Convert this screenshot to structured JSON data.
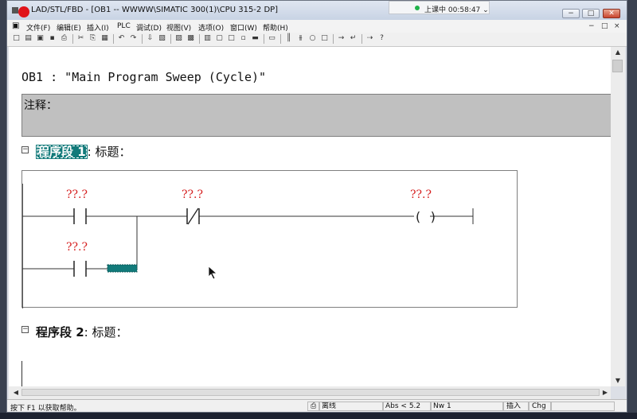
{
  "window": {
    "title": "LAD/STL/FBD  - [OB1 -- WWWW\\SIMATIC 300(1)\\CPU 315-2 DP]",
    "min_glyph": "−",
    "max_glyph": "□",
    "close_glyph": "✕"
  },
  "session": {
    "label": "上课中 00:58:47 ⌄"
  },
  "menu": {
    "items": [
      "文件(F)",
      "编辑(E)",
      "插入(I)",
      "PLC",
      "调试(D)",
      "视图(V)",
      "选项(O)",
      "窗口(W)",
      "帮助(H)"
    ],
    "mdi": [
      "−",
      "□",
      "×"
    ]
  },
  "toolbar": {
    "icons": [
      "new-icon",
      "open-icon",
      "accessible-nodes-icon",
      "save-icon",
      "print-icon",
      "cut-icon",
      "copy-icon",
      "paste-icon",
      "undo-icon",
      "redo-icon",
      "load-icon",
      "module-info-icon",
      "monitor-icon",
      "overview-icon",
      "details-icon",
      "symbol-info-icon",
      "address-info-icon",
      "comment-icon",
      "network-icon",
      "toggle-view-icon",
      "contact-no-icon",
      "contact-nc-icon",
      "coil-icon",
      "box-icon",
      "branch-open-icon",
      "branch-close-icon",
      "connection-icon",
      "help-icon"
    ],
    "glyphs": [
      "□",
      "▤",
      "▣",
      "▪",
      "⎙",
      "✂",
      "⎘",
      "▦",
      "↶",
      "↷",
      "⇩",
      "▧",
      "▨",
      "▩",
      "▥",
      "▢",
      "□",
      "▫",
      "▬",
      "▭",
      "║",
      "⫵",
      "○",
      "□",
      "→",
      "↵",
      "⇢",
      "?"
    ]
  },
  "editor": {
    "block_title": "OB1 :  \"Main Program Sweep (Cycle)\"",
    "comment_label": "注释：",
    "network1": {
      "number_label": "程序段 1",
      "title_suffix": ": 标题："
    },
    "network2": {
      "number_label": "程序段 2",
      "title_suffix": ": 标题："
    },
    "expander_glyph": "−",
    "ladder": {
      "contact1_address": "??.?",
      "contact2_address": "??.?",
      "coil_address": "??.?",
      "contact3_address": "??.?",
      "coil_symbol": "( )",
      "insert_color": "#127a7a",
      "address_color": "#d62020"
    }
  },
  "scroll": {
    "up": "▲",
    "down": "▼",
    "left": "◀",
    "right": "▶"
  },
  "status": {
    "help": "按下 F1 以获取帮助。",
    "mode_icon": "⎙",
    "online": "离线",
    "abs": "Abs < 5.2",
    "nw": "Nw 1",
    "insert": "插入",
    "chg": "Chg"
  }
}
